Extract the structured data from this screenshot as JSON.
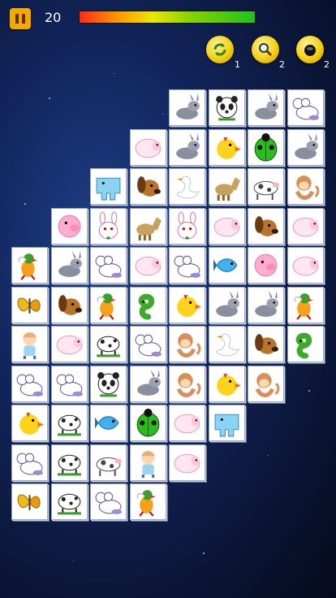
{
  "hud": {
    "score": "20",
    "time_remaining_fraction": 1.0,
    "pause_icon": "pause-icon"
  },
  "tools": [
    {
      "name": "shuffle",
      "icon": "shuffle-icon",
      "count": "1"
    },
    {
      "name": "hint",
      "icon": "magnifier-icon",
      "count": "2"
    },
    {
      "name": "bomb",
      "icon": "bomb-icon",
      "count": "2"
    }
  ],
  "board": {
    "rows": [
      [
        "",
        "",
        "",
        "",
        "donkey",
        "panda",
        "donkey",
        "mouse"
      ],
      [
        "",
        "",
        "",
        "sheep",
        "donkey",
        "chick",
        "ladybug",
        "donkey"
      ],
      [
        "",
        "",
        "elephant",
        "dog",
        "swan",
        "horse",
        "cow",
        "monkey"
      ],
      [
        "",
        "pig",
        "bunny",
        "horse",
        "bunny",
        "sheep",
        "dog",
        "sheep"
      ],
      [
        "bird",
        "donkey",
        "mouse",
        "sheep",
        "mouse",
        "fish",
        "pig",
        "sheep"
      ],
      [
        "butterfly",
        "dog",
        "bird",
        "snake",
        "chick",
        "donkey",
        "donkey",
        "bird"
      ],
      [
        "boy",
        "sheep",
        "dalmatian",
        "mouse",
        "monkey",
        "swan",
        "dog",
        "snake"
      ],
      [
        "mouse",
        "mouse",
        "panda",
        "donkey",
        "monkey",
        "chick",
        "monkey",
        ""
      ],
      [
        "chick",
        "dalmatian",
        "fish",
        "ladybug",
        "sheep",
        "elephant",
        "",
        ""
      ],
      [
        "mouse",
        "dalmatian",
        "cow",
        "boy",
        "sheep",
        "",
        "",
        ""
      ],
      [
        "butterfly",
        "dalmatian",
        "mouse",
        "bird",
        "",
        "",
        "",
        ""
      ]
    ]
  },
  "colors": {
    "background": "#0a1433",
    "pause": "#f2a900",
    "tool": "#f4cf12",
    "tile_border": "#9aa7c6"
  }
}
